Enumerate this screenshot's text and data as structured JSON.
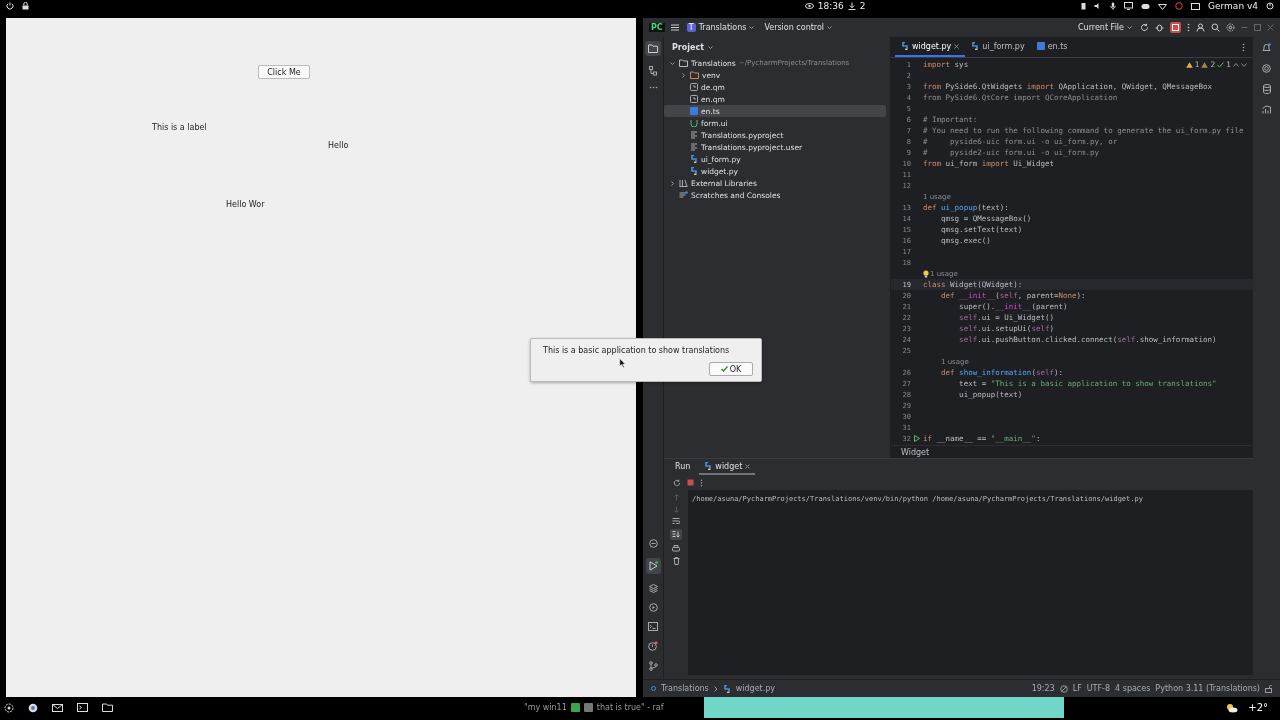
{
  "system_bar": {
    "time": "18:36",
    "downloads": "2",
    "keyboard_layout": "German v4"
  },
  "app_window": {
    "button": "Click Me",
    "labels": [
      "This is a label",
      "Hello",
      "Hello Wor"
    ]
  },
  "message_box": {
    "text": "This is a basic application to show translations",
    "button": "OK"
  },
  "ide": {
    "title_bar": {
      "logo": "PC",
      "project_badge": "T",
      "project": "Translations",
      "vcs": "Version control",
      "run_config": "Current File"
    },
    "project_panel": {
      "title": "Project",
      "tree": [
        {
          "label": "Translations",
          "path": "~/PycharmProjects/Translations",
          "kind": "folder",
          "expanded": true,
          "selected": false,
          "children": [
            {
              "label": "venv",
              "kind": "folder",
              "expanded": false,
              "selected": false
            },
            {
              "label": "de.qm",
              "kind": "qm",
              "selected": false
            },
            {
              "label": "en.qm",
              "kind": "qm",
              "selected": false
            },
            {
              "label": "en.ts",
              "kind": "ts",
              "selected": true
            },
            {
              "label": "form.ui",
              "kind": "ui",
              "selected": false
            },
            {
              "label": "Translations.pyproject",
              "kind": "text",
              "selected": false
            },
            {
              "label": "Translations.pyproject.user",
              "kind": "text",
              "selected": false
            },
            {
              "label": "ui_form.py",
              "kind": "python",
              "selected": false
            },
            {
              "label": "widget.py",
              "kind": "python",
              "selected": false
            }
          ]
        },
        {
          "label": "External Libraries",
          "kind": "library",
          "expanded": false,
          "selected": false
        },
        {
          "label": "Scratches and Consoles",
          "kind": "scratch",
          "selected": false
        }
      ]
    },
    "editor_tabs": [
      {
        "label": "widget.py",
        "kind": "python",
        "selected": true
      },
      {
        "label": "ui_form.py",
        "kind": "python",
        "selected": false
      },
      {
        "label": "en.ts",
        "kind": "ts",
        "selected": false
      }
    ],
    "inspections": {
      "warnings": "1",
      "weak_warnings": "2",
      "ok": "1"
    },
    "code": [
      {
        "kind": "code",
        "number": "1",
        "current": false,
        "segments": [
          {
            "kind": "keyword",
            "text": "import"
          },
          {
            "kind": "plain",
            "text": " sys"
          }
        ]
      },
      {
        "kind": "code",
        "number": "2",
        "current": false
      },
      {
        "kind": "code",
        "number": "3",
        "current": false,
        "segments": [
          {
            "kind": "keyword",
            "text": "from"
          },
          {
            "kind": "plain",
            "text": " PySide6.QtWidgets "
          },
          {
            "kind": "keyword",
            "text": "import"
          },
          {
            "kind": "plain",
            "text": " QApplication, QWidget, QMessageBox"
          }
        ]
      },
      {
        "kind": "code",
        "number": "4",
        "current": false,
        "segments": [
          {
            "kind": "comment",
            "text": "from PySide6.QtCore import QCoreApplication"
          }
        ]
      },
      {
        "kind": "code",
        "number": "5",
        "current": false
      },
      {
        "kind": "code",
        "number": "6",
        "current": false,
        "segments": [
          {
            "kind": "comment",
            "text": "# Important:"
          }
        ]
      },
      {
        "kind": "code",
        "number": "7",
        "current": false,
        "segments": [
          {
            "kind": "comment",
            "text": "# You need to run the following command to generate the ui_form.py file"
          }
        ]
      },
      {
        "kind": "code",
        "number": "8",
        "current": false,
        "segments": [
          {
            "kind": "comment",
            "text": "#     pyside6-uic form.ui -o ui_form.py, or"
          }
        ]
      },
      {
        "kind": "code",
        "number": "9",
        "current": false,
        "segments": [
          {
            "kind": "comment",
            "text": "#     pyside2-uic form.ui -o ui_form.py"
          }
        ]
      },
      {
        "kind": "code",
        "number": "10",
        "current": false,
        "segments": [
          {
            "kind": "keyword",
            "text": "from"
          },
          {
            "kind": "plain",
            "text": " ui_form "
          },
          {
            "kind": "keyword",
            "text": "import"
          },
          {
            "kind": "plain",
            "text": " Ui_Widget"
          }
        ]
      },
      {
        "kind": "code",
        "number": "11",
        "current": false
      },
      {
        "kind": "code",
        "number": "12",
        "current": false
      },
      {
        "kind": "hint",
        "text": "1 usage",
        "bulb": false
      },
      {
        "kind": "code",
        "number": "13",
        "current": false,
        "segments": [
          {
            "kind": "keyword",
            "text": "def"
          },
          {
            "kind": "func",
            "text": " ui_popup"
          },
          {
            "kind": "plain",
            "text": "(text):"
          }
        ]
      },
      {
        "kind": "code",
        "number": "14",
        "current": false,
        "segments": [
          {
            "kind": "plain",
            "text": "    qmsg = QMessageBox()"
          }
        ]
      },
      {
        "kind": "code",
        "number": "15",
        "current": false,
        "segments": [
          {
            "kind": "plain",
            "text": "    qmsg.setText(text)"
          }
        ]
      },
      {
        "kind": "code",
        "number": "16",
        "current": false,
        "segments": [
          {
            "kind": "plain",
            "text": "    qmsg.exec()"
          }
        ]
      },
      {
        "kind": "code",
        "number": "17",
        "current": false
      },
      {
        "kind": "code",
        "number": "18",
        "current": false
      },
      {
        "kind": "hint",
        "text": "1 usage",
        "bulb": true
      },
      {
        "kind": "code",
        "number": "19",
        "current": true,
        "segments": [
          {
            "kind": "keyword",
            "text": "class"
          },
          {
            "kind": "plain",
            "text": " Widget(QWidget):"
          }
        ]
      },
      {
        "kind": "code",
        "number": "20",
        "current": false,
        "segments": [
          {
            "kind": "keyword",
            "text": "    def"
          },
          {
            "kind": "magic",
            "text": " __init__"
          },
          {
            "kind": "plain",
            "text": "("
          },
          {
            "kind": "self",
            "text": "self"
          },
          {
            "kind": "plain",
            "text": ", parent="
          },
          {
            "kind": "keyword",
            "text": "None"
          },
          {
            "kind": "plain",
            "text": "):"
          }
        ]
      },
      {
        "kind": "code",
        "number": "21",
        "current": false,
        "segments": [
          {
            "kind": "plain",
            "text": "        super()."
          },
          {
            "kind": "magic",
            "text": "__init__"
          },
          {
            "kind": "plain",
            "text": "(parent)"
          }
        ]
      },
      {
        "kind": "code",
        "number": "22",
        "current": false,
        "segments": [
          {
            "kind": "self",
            "text": "        self"
          },
          {
            "kind": "plain",
            "text": ".ui = Ui_Widget()"
          }
        ]
      },
      {
        "kind": "code",
        "number": "23",
        "current": false,
        "segments": [
          {
            "kind": "self",
            "text": "        self"
          },
          {
            "kind": "plain",
            "text": ".ui.setupUi("
          },
          {
            "kind": "self",
            "text": "self"
          },
          {
            "kind": "plain",
            "text": ")"
          }
        ]
      },
      {
        "kind": "code",
        "number": "24",
        "current": false,
        "segments": [
          {
            "kind": "self",
            "text": "        self"
          },
          {
            "kind": "plain",
            "text": ".ui.pushButton.clicked.connect("
          },
          {
            "kind": "self",
            "text": "self"
          },
          {
            "kind": "plain",
            "text": ".show_information)"
          }
        ]
      },
      {
        "kind": "code",
        "number": "25",
        "current": false
      },
      {
        "kind": "hint",
        "text": "1 usage",
        "bulb": false
      },
      {
        "kind": "code",
        "number": "26",
        "current": false,
        "segments": [
          {
            "kind": "keyword",
            "text": "    def"
          },
          {
            "kind": "func",
            "text": " show_information"
          },
          {
            "kind": "plain",
            "text": "("
          },
          {
            "kind": "self",
            "text": "self"
          },
          {
            "kind": "plain",
            "text": "):"
          }
        ]
      },
      {
        "kind": "code",
        "number": "27",
        "current": false,
        "segments": [
          {
            "kind": "plain",
            "text": "        text = "
          },
          {
            "kind": "string",
            "text": "\"This is a basic application to show translations\""
          }
        ]
      },
      {
        "kind": "code",
        "number": "28",
        "current": false,
        "segments": [
          {
            "kind": "plain",
            "text": "        ui_popup(text)"
          }
        ]
      },
      {
        "kind": "code",
        "number": "29",
        "current": false
      },
      {
        "kind": "code",
        "number": "30",
        "current": false
      },
      {
        "kind": "code",
        "number": "31",
        "current": false
      },
      {
        "kind": "runnable",
        "number": "32",
        "current": false,
        "segments": [
          {
            "kind": "keyword",
            "text": "if"
          },
          {
            "kind": "plain",
            "text": " __name__ == "
          },
          {
            "kind": "string",
            "text": "\"__main__\""
          },
          {
            "kind": "plain",
            "text": ":"
          }
        ]
      }
    ],
    "breadcrumb": "Widget",
    "run_panel": {
      "tabs": [
        {
          "label": "Run",
          "selected": false
        },
        {
          "label": "widget",
          "selected": true
        }
      ],
      "output": "/home/asuna/PycharmProjects/Translations/venv/bin/python /home/asuna/PycharmProjects/Translations/widget.py"
    },
    "status_bar": {
      "path": [
        "Translations",
        "widget.py"
      ],
      "position": "19:23",
      "line_separator": "LF",
      "encoding": "UTF-8",
      "indent": "4 spaces",
      "interpreter": "Python 3.11 (Translations)"
    }
  },
  "taskbar": {
    "quote_parts": [
      "\"my win11",
      "that is true\" - raf"
    ],
    "temperature": "+2°"
  }
}
